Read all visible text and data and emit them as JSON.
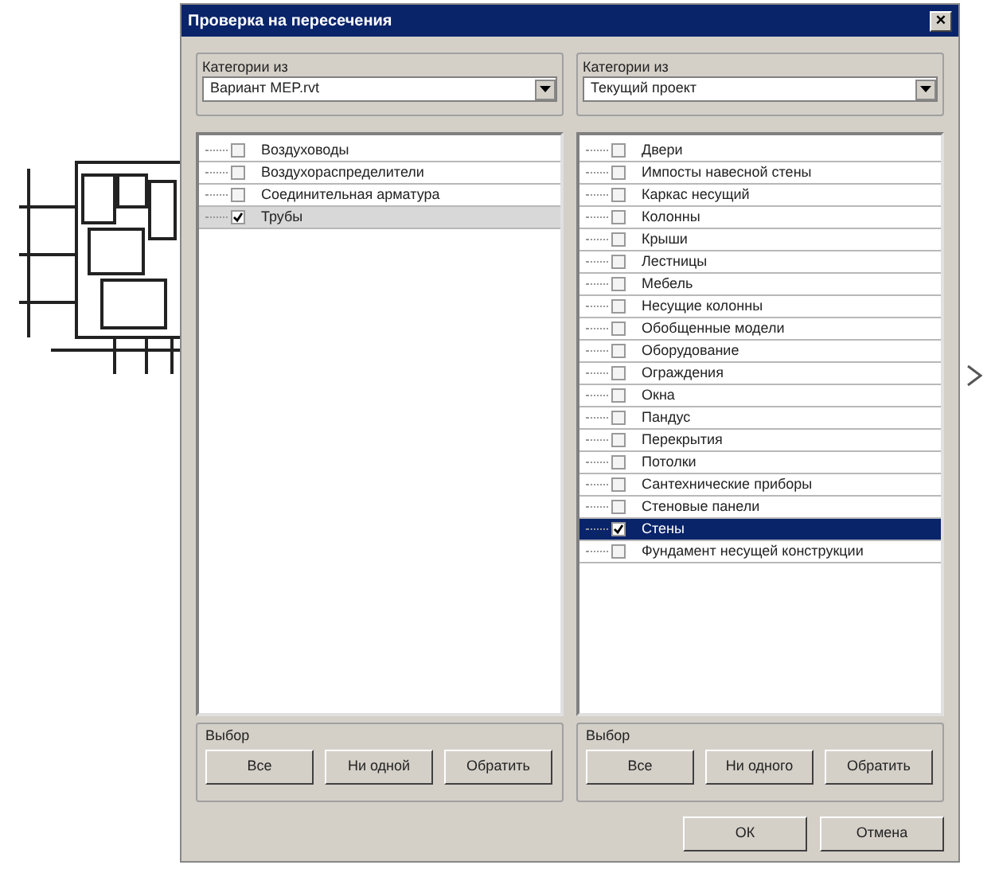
{
  "window": {
    "title": "Проверка на пересечения",
    "close": "×"
  },
  "panels": [
    {
      "group_label": "Категории из",
      "source": "Вариант MEP.rvt",
      "items": [
        {
          "label": "Воздуховоды",
          "checked": false,
          "selected": false
        },
        {
          "label": "Воздухораспределители",
          "checked": false,
          "selected": false
        },
        {
          "label": "Соединительная арматура",
          "checked": false,
          "selected": false
        },
        {
          "label": "Трубы",
          "checked": true,
          "selected": false,
          "highlighted": true
        }
      ],
      "selection_label": "Выбор",
      "buttons": [
        "Все",
        "Ни одной",
        "Обратить"
      ]
    },
    {
      "group_label": "Категории из",
      "source": "Текущий проект",
      "items": [
        {
          "label": "Двери",
          "checked": false,
          "selected": false
        },
        {
          "label": "Импосты навесной стены",
          "checked": false,
          "selected": false
        },
        {
          "label": "Каркас несущий",
          "checked": false,
          "selected": false
        },
        {
          "label": "Колонны",
          "checked": false,
          "selected": false
        },
        {
          "label": "Крыши",
          "checked": false,
          "selected": false
        },
        {
          "label": "Лестницы",
          "checked": false,
          "selected": false
        },
        {
          "label": "Мебель",
          "checked": false,
          "selected": false
        },
        {
          "label": "Несущие колонны",
          "checked": false,
          "selected": false
        },
        {
          "label": "Обобщенные модели",
          "checked": false,
          "selected": false
        },
        {
          "label": "Оборудование",
          "checked": false,
          "selected": false
        },
        {
          "label": "Ограждения",
          "checked": false,
          "selected": false
        },
        {
          "label": "Окна",
          "checked": false,
          "selected": false
        },
        {
          "label": "Пандус",
          "checked": false,
          "selected": false
        },
        {
          "label": "Перекрытия",
          "checked": false,
          "selected": false
        },
        {
          "label": "Потолки",
          "checked": false,
          "selected": false
        },
        {
          "label": "Сантехнические приборы",
          "checked": false,
          "selected": false
        },
        {
          "label": "Стеновые панели",
          "checked": false,
          "selected": false
        },
        {
          "label": "Стены",
          "checked": true,
          "selected": true
        },
        {
          "label": "Фундамент несущей конструкции",
          "checked": false,
          "selected": false
        }
      ],
      "selection_label": "Выбор",
      "buttons": [
        "Все",
        "Ни одного",
        "Обратить"
      ]
    }
  ],
  "buttons": [
    "ОК",
    "Отмена"
  ]
}
